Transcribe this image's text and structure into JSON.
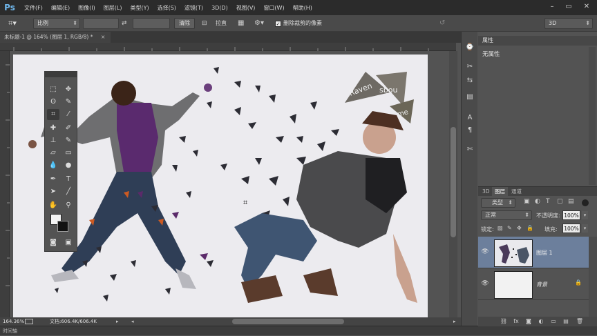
{
  "app": {
    "logo": "Ps"
  },
  "menu": [
    "文件(F)",
    "编辑(E)",
    "图像(I)",
    "图层(L)",
    "类型(Y)",
    "选择(S)",
    "滤镜(T)",
    "3D(D)",
    "视图(V)",
    "窗口(W)",
    "帮助(H)"
  ],
  "options": {
    "ratio_label": "比例",
    "clear_label": "清除",
    "straighten_label": "拉直",
    "delete_cropped_label": "删除裁剪的像素",
    "delete_cropped_checked": true,
    "workspace": "3D"
  },
  "document": {
    "tab_title": "未标题-1 @ 164% (图层 1, RGB/8) *"
  },
  "status": {
    "zoom": "164.36%",
    "doc_size": "文档:606.4K/606.4K"
  },
  "timeline_label": "时间轴",
  "properties": {
    "tab": "属性",
    "text": "无属性"
  },
  "layers_panel": {
    "tabs": [
      "3D",
      "图层",
      "通道"
    ],
    "active_tab": "图层",
    "filter_kind": "类型",
    "blend_mode": "正常",
    "opacity_label": "不透明度:",
    "opacity_value": "100%",
    "lock_label": "锁定:",
    "fill_label": "填充:",
    "fill_value": "100%",
    "layers": [
      {
        "name": "图层 1",
        "selected": true
      },
      {
        "name": "背景",
        "selected": false,
        "locked": true
      }
    ]
  },
  "artwork": {
    "logo_text": [
      "Raven",
      "sbou",
      "me"
    ]
  },
  "colors": {
    "accent_selected_layer": "#6c7f9c",
    "logo_blue": "#6fb6ea"
  }
}
